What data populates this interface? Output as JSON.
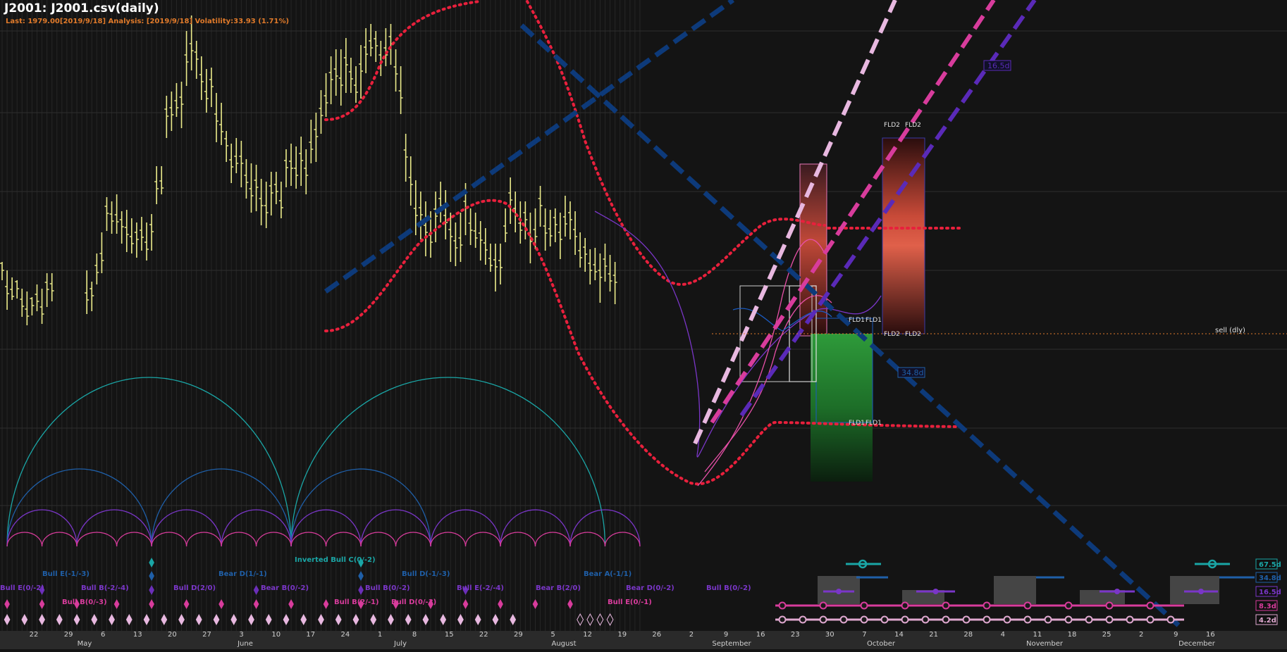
{
  "header": {
    "title": "J2001: J2001.csv(daily)",
    "status": "Last: 1979.00[2019/9/18] Analysis: [2019/9/18] Volatility:33.93 (1.71%)"
  },
  "colors": {
    "background": "#141414",
    "price_bars": "#ecec8c",
    "envelope": "#e8203c",
    "trend_navy": "#0d3a7a",
    "cycle_teal": "#1aa6a6",
    "cycle_blue": "#1f5fa8",
    "cycle_purple": "#7a36c8",
    "cycle_pink": "#d83c9c",
    "cycle_light": "#e0a8d0"
  },
  "chart_data": {
    "type": "bar",
    "ohlc_bars": [
      [
        0,
        372,
        398
      ],
      [
        1,
        384,
        440
      ],
      [
        2,
        394,
        426
      ],
      [
        3,
        398,
        424
      ],
      [
        4,
        410,
        450
      ],
      [
        5,
        414,
        462
      ],
      [
        6,
        422,
        448
      ],
      [
        7,
        404,
        442
      ],
      [
        8,
        410,
        460
      ],
      [
        9,
        388,
        436
      ],
      [
        10,
        388,
        428
      ],
      [
        17,
        384,
        446
      ],
      [
        18,
        400,
        442
      ],
      [
        19,
        360,
        404
      ],
      [
        20,
        330,
        388
      ],
      [
        21,
        280,
        328
      ],
      [
        22,
        286,
        332
      ],
      [
        23,
        276,
        332
      ],
      [
        24,
        300,
        346
      ],
      [
        25,
        298,
        358
      ],
      [
        26,
        310,
        360
      ],
      [
        27,
        316,
        366
      ],
      [
        28,
        308,
        356
      ],
      [
        29,
        316,
        370
      ],
      [
        30,
        304,
        356
      ],
      [
        31,
        236,
        290
      ],
      [
        32,
        236,
        276
      ],
      [
        33,
        136,
        196
      ],
      [
        34,
        130,
        186
      ],
      [
        35,
        118,
        166
      ],
      [
        36,
        116,
        182
      ],
      [
        37,
        44,
        122
      ],
      [
        38,
        22,
        100
      ],
      [
        39,
        58,
        112
      ],
      [
        40,
        80,
        142
      ],
      [
        41,
        98,
        160
      ],
      [
        42,
        96,
        152
      ],
      [
        43,
        132,
        202
      ],
      [
        44,
        146,
        206
      ],
      [
        45,
        186,
        230
      ],
      [
        46,
        204,
        260
      ],
      [
        47,
        196,
        246
      ],
      [
        48,
        200,
        266
      ],
      [
        49,
        226,
        282
      ],
      [
        50,
        232,
        302
      ],
      [
        51,
        234,
        300
      ],
      [
        52,
        254,
        320
      ],
      [
        53,
        258,
        324
      ],
      [
        54,
        244,
        306
      ],
      [
        55,
        244,
        290
      ],
      [
        56,
        258,
        310
      ],
      [
        57,
        212,
        266
      ],
      [
        58,
        204,
        264
      ],
      [
        59,
        208,
        268
      ],
      [
        60,
        194,
        264
      ],
      [
        61,
        212,
        276
      ],
      [
        62,
        170,
        232
      ],
      [
        63,
        160,
        230
      ],
      [
        64,
        128,
        190
      ],
      [
        65,
        104,
        166
      ],
      [
        66,
        80,
        148
      ],
      [
        67,
        70,
        136
      ],
      [
        68,
        70,
        150
      ],
      [
        69,
        54,
        132
      ],
      [
        70,
        82,
        132
      ],
      [
        71,
        94,
        146
      ],
      [
        72,
        64,
        140
      ],
      [
        73,
        40,
        104
      ],
      [
        74,
        34,
        80
      ],
      [
        75,
        44,
        88
      ],
      [
        76,
        58,
        108
      ],
      [
        77,
        40,
        94
      ],
      [
        78,
        34,
        92
      ],
      [
        79,
        70,
        130
      ],
      [
        80,
        94,
        162
      ],
      [
        81,
        190,
        258
      ],
      [
        82,
        222,
        292
      ],
      [
        83,
        256,
        334
      ],
      [
        84,
        272,
        340
      ],
      [
        85,
        286,
        364
      ],
      [
        86,
        300,
        366
      ],
      [
        87,
        272,
        344
      ],
      [
        88,
        258,
        316
      ],
      [
        89,
        270,
        340
      ],
      [
        90,
        302,
        372
      ],
      [
        91,
        316,
        378
      ],
      [
        92,
        302,
        372
      ],
      [
        93,
        260,
        334
      ],
      [
        94,
        296,
        348
      ],
      [
        95,
        302,
        352
      ],
      [
        96,
        314,
        370
      ],
      [
        97,
        324,
        376
      ],
      [
        98,
        346,
        386
      ],
      [
        99,
        346,
        414
      ],
      [
        100,
        346,
        404
      ],
      [
        101,
        296,
        344
      ],
      [
        102,
        252,
        318
      ],
      [
        103,
        272,
        330
      ],
      [
        104,
        286,
        346
      ],
      [
        105,
        286,
        340
      ],
      [
        106,
        302,
        374
      ],
      [
        107,
        296,
        354
      ],
      [
        108,
        264,
        322
      ],
      [
        109,
        296,
        356
      ],
      [
        110,
        298,
        350
      ],
      [
        111,
        296,
        344
      ],
      [
        112,
        302,
        368
      ],
      [
        113,
        278,
        336
      ],
      [
        114,
        286,
        340
      ],
      [
        115,
        300,
        362
      ],
      [
        116,
        330,
        380
      ],
      [
        117,
        338,
        386
      ],
      [
        118,
        354,
        404
      ],
      [
        119,
        352,
        398
      ],
      [
        120,
        360,
        430
      ],
      [
        121,
        346,
        400
      ],
      [
        122,
        362,
        414
      ],
      [
        123,
        372,
        432
      ]
    ],
    "cycles": [
      {
        "name": "67.5d",
        "color": "#1aa6a6",
        "troughs": [
          1,
          58,
          121
        ]
      },
      {
        "name": "34.8d",
        "color": "#1f5fa8",
        "troughs": [
          1,
          30,
          58,
          86
        ]
      },
      {
        "name": "16.5d",
        "color": "#7a36c8",
        "troughs": [
          1,
          15,
          30,
          44,
          58,
          72,
          86,
          100,
          114,
          128
        ]
      },
      {
        "name": "8.3d",
        "color": "#d83c9c",
        "troughs": [
          1,
          8,
          15,
          23,
          30,
          37,
          44,
          51,
          58,
          65,
          72,
          79,
          86,
          93,
          100,
          107,
          114,
          121,
          128
        ]
      },
      {
        "name": "4.2d",
        "color": "#e0a8d0",
        "troughs": []
      }
    ],
    "cycle_labels": [
      "67.5d",
      "34.8d",
      "16.5d",
      "8.3d",
      "4.2d"
    ],
    "trend_line_labels": [
      "16.5d",
      "34.8d"
    ],
    "fld_labels": [
      "FLD2",
      "FLD2",
      "FLD2",
      "FLD2",
      "FLD1",
      "FLD1",
      "FLD1",
      "FLD1"
    ],
    "sell_label": "sell (dly)",
    "signal_labels": [
      {
        "text": "Bull E(-1/-3)",
        "color": "#1f5fa8"
      },
      {
        "text": "Bear D(1/-1)",
        "color": "#1f5fa8"
      },
      {
        "text": "Inverted Bull C(0/-2)",
        "color": "#1aa6a6"
      },
      {
        "text": "Bull D(-1/-3)",
        "color": "#1f5fa8"
      },
      {
        "text": "Bear A(-1/1)",
        "color": "#1f5fa8"
      },
      {
        "text": "Bull E(0/-2)",
        "color": "#7a36c8"
      },
      {
        "text": "Bull B(-2/-4)",
        "color": "#7a36c8"
      },
      {
        "text": "Bull D(2/0)",
        "color": "#7a36c8"
      },
      {
        "text": "Bear B(0/-2)",
        "color": "#7a36c8"
      },
      {
        "text": "Bull B(0/-2)",
        "color": "#7a36c8"
      },
      {
        "text": "Bull E(-2/-4)",
        "color": "#7a36c8"
      },
      {
        "text": "Bear B(2/0)",
        "color": "#7a36c8"
      },
      {
        "text": "Bear D(0/-2)",
        "color": "#7a36c8"
      },
      {
        "text": "Bull B(0/-2)",
        "color": "#7a36c8"
      },
      {
        "text": "Bull B(0/-3)",
        "color": "#d83c9c"
      },
      {
        "text": "Bull B(2/-1)",
        "color": "#d83c9c"
      },
      {
        "text": "Bull D(0/-3)",
        "color": "#d83c9c"
      },
      {
        "text": "Bull E(0/-1)",
        "color": "#d83c9c"
      }
    ],
    "x_ticks": [
      "22",
      "29",
      "6",
      "13",
      "20",
      "27",
      "3",
      "10",
      "17",
      "24",
      "1",
      "8",
      "15",
      "22",
      "29",
      "5",
      "12",
      "19",
      "26",
      "2",
      "9",
      "16",
      "23",
      "30",
      "7",
      "14",
      "21",
      "28",
      "4",
      "11",
      "18",
      "25",
      "2",
      "9",
      "16"
    ],
    "month_labels": [
      "May",
      "June",
      "July",
      "August",
      "September",
      "October",
      "November",
      "December"
    ]
  }
}
